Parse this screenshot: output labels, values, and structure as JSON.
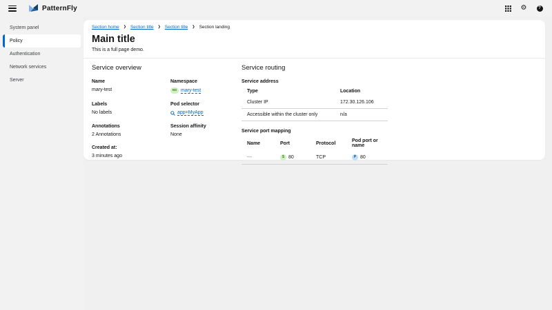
{
  "colors": {
    "page-bg": "#f0f0f0",
    "chrome-bg": "#f2f2f2",
    "accent": "#0066cc",
    "link": "#0066cc",
    "text": "#151515",
    "green-bg": "#d1f1c2",
    "green-fg": "#3d7317",
    "blue-bg": "#c3def5",
    "blue-fg": "#004b95"
  },
  "masthead": {
    "brand": "PatternFly",
    "icons": [
      "menu-icon",
      "app-launcher-grid-icon",
      "settings-gear-icon",
      "help-question-icon"
    ],
    "help_glyph": "?",
    "gear_glyph": "⚙"
  },
  "sidebar": {
    "items": [
      {
        "label": "System panel",
        "selected": false
      },
      {
        "label": "Policy",
        "selected": true
      },
      {
        "label": "Authentication",
        "selected": false
      },
      {
        "label": "Network services",
        "selected": false
      },
      {
        "label": "Server",
        "selected": false
      }
    ]
  },
  "breadcrumb": {
    "items": [
      {
        "label": "Section home"
      },
      {
        "label": "Section title"
      },
      {
        "label": "Section title"
      },
      {
        "label": "Section landing"
      }
    ],
    "separator": "❯"
  },
  "page": {
    "title": "Main title",
    "subtitle": "This is a full page demo."
  },
  "overview": {
    "heading": "Service overview",
    "name_label": "Name",
    "name_value": "mary-test",
    "namespace_label": "Namespace",
    "namespace_badge": "NS",
    "namespace_value": "mary-test",
    "labels_label": "Labels",
    "labels_value": "No labels",
    "pod_selector_label": "Pod selector",
    "pod_selector_value": "app=MyApp",
    "annotations_label": "Annotations",
    "annotations_value": "2 Annotations",
    "session_affinity_label": "Session affinity",
    "session_affinity_value": "None",
    "created_label": "Created at:",
    "created_value": "3 minutes ago"
  },
  "routing": {
    "heading": "Service routing",
    "address": {
      "heading": "Service address",
      "columns": [
        "Type",
        "Location"
      ],
      "rows": [
        [
          "Cluster IP",
          "172.30.126.106"
        ],
        [
          "Accessible within the cluster only",
          "n/a"
        ]
      ]
    },
    "ports": {
      "heading": "Service port mapping",
      "columns": [
        "Name",
        "Port",
        "Protocol",
        "Pod port or name"
      ],
      "rows": [
        {
          "name": "---",
          "port_badge": "S",
          "port": "80",
          "protocol": "TCP",
          "pod_badge": "P",
          "pod_port": "80"
        }
      ]
    }
  }
}
